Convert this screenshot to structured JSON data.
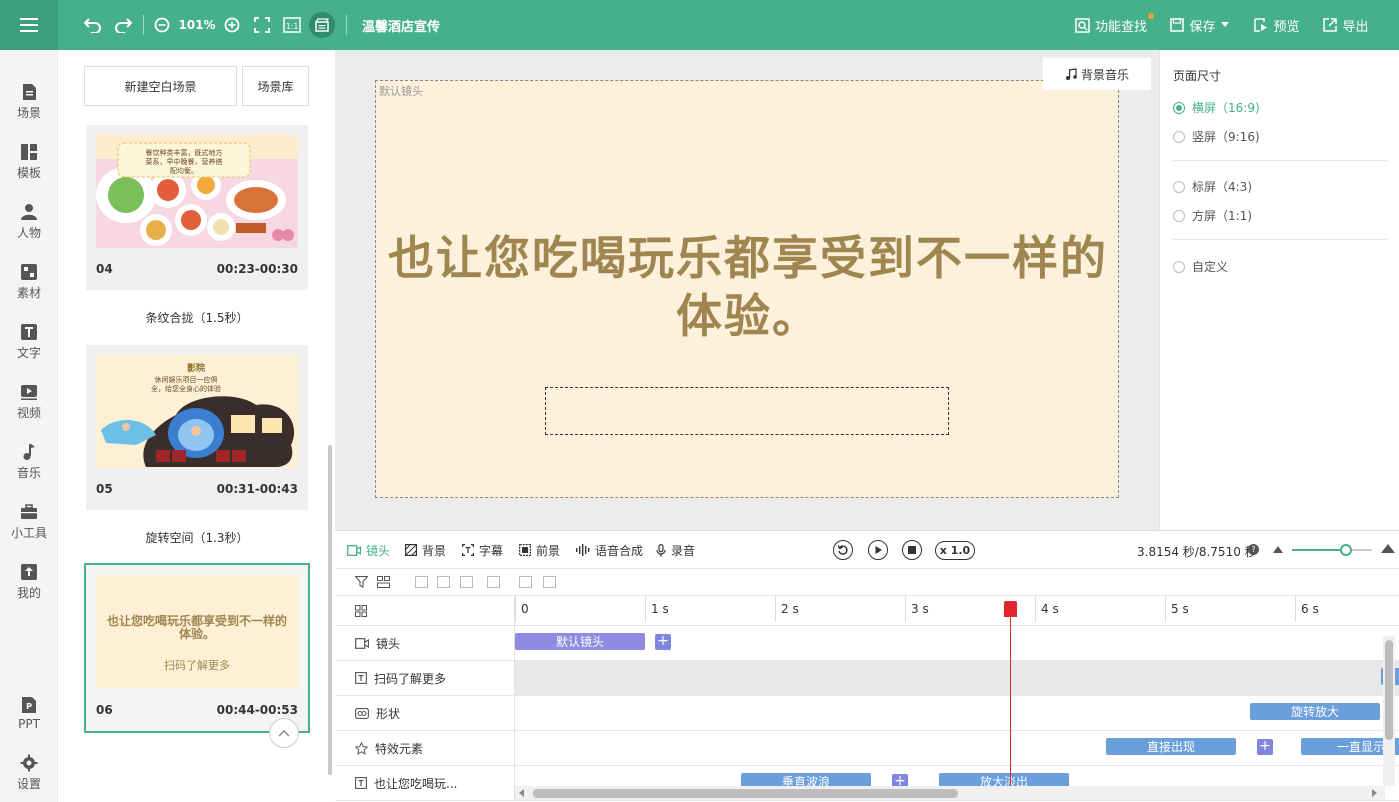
{
  "topbar": {
    "zoom": "101%",
    "project_title": "温馨酒店宣传",
    "search_feature": "功能查找",
    "save": "保存",
    "preview": "预览",
    "export": "导出"
  },
  "leftnav": {
    "items": [
      {
        "label": "场景"
      },
      {
        "label": "模板"
      },
      {
        "label": "人物"
      },
      {
        "label": "素材"
      },
      {
        "label": "文字"
      },
      {
        "label": "视频"
      },
      {
        "label": "音乐"
      },
      {
        "label": "小工具"
      },
      {
        "label": "我的"
      },
      {
        "label": "PPT"
      },
      {
        "label": "设置"
      }
    ]
  },
  "scene_panel": {
    "new_blank_scene": "新建空白场景",
    "scene_library": "场景库",
    "scenes": [
      {
        "num": "04",
        "time": "00:23-00:30",
        "transition": "条纹合拢（1.5秒）",
        "thumb_text": "餐饮种类丰富，既式地方菜系，早中晚餐，营养搭配均衡。"
      },
      {
        "num": "05",
        "time": "00:31-00:43",
        "transition": "旋转空间（1.3秒）",
        "thumb_text": "休闲娱乐项目一应俱全，给您全身心的体验"
      },
      {
        "num": "06",
        "time": "00:44-00:53",
        "thumb_text": "也让您吃喝玩乐都享受到不一样的体验。",
        "thumb_sub": "扫码了解更多"
      }
    ]
  },
  "canvas": {
    "camera_label": "默认镜头",
    "bgm_button": "背景音乐",
    "main_text": "也让您吃喝玩乐都享受到不一样的体验。"
  },
  "right_panel": {
    "title": "页面尺寸",
    "options": [
      {
        "label": "横屏（16:9)",
        "selected": true
      },
      {
        "label": "竖屏（9:16)",
        "selected": false
      },
      {
        "label": "标屏（4:3)",
        "selected": false
      },
      {
        "label": "方屏（1:1)",
        "selected": false
      },
      {
        "label": "自定义",
        "selected": false
      }
    ]
  },
  "timeline": {
    "tabs": [
      "镜头",
      "背景",
      "字幕",
      "前景",
      "语音合成",
      "录音"
    ],
    "speed": "x 1.0",
    "time_readout": "3.8154 秒/8.7510 秒",
    "zoom_level": 0.68,
    "ruler": [
      "0",
      "1 s",
      "2 s",
      "3 s",
      "4 s",
      "5 s",
      "6 s"
    ],
    "tracks": [
      {
        "label": "镜头",
        "clips": [
          {
            "text": "默认镜头"
          }
        ]
      },
      {
        "label": "扫码了解更多",
        "clips": []
      },
      {
        "label": "形状",
        "clips": [
          {
            "text": "旋转放大"
          }
        ]
      },
      {
        "label": "特效元素",
        "clips": [
          {
            "text": "直接出现"
          },
          {
            "text": "一直显示"
          }
        ]
      },
      {
        "label": "也让您吃喝玩...",
        "clips": [
          {
            "text": "垂直波浪"
          },
          {
            "text": "放大淡出"
          }
        ]
      }
    ]
  },
  "colors": {
    "brand": "#46af8c",
    "stage_bg": "#fdf1dc",
    "stage_text": "#9f8650",
    "clip_blue": "#6a9fdc",
    "clip_purple": "#8d8ce0",
    "playhead": "#e0262c"
  }
}
